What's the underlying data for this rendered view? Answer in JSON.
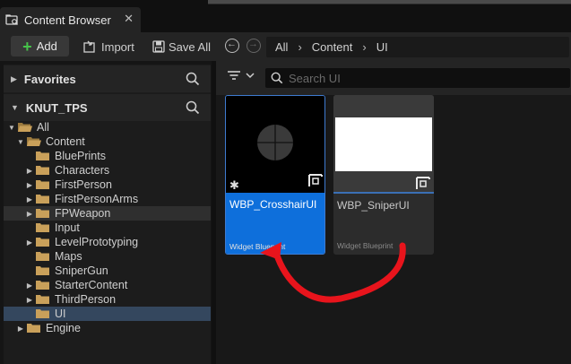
{
  "tab": {
    "title": "Content Browser",
    "icon": "content-browser-icon",
    "close_icon": "close-icon",
    "close_glyph": "✕"
  },
  "toolbar": {
    "add_label": "Add",
    "import_label": "Import",
    "save_all_label": "Save All",
    "back_icon": "arrow-left-circle-icon",
    "forward_icon": "arrow-right-circle-icon"
  },
  "breadcrumb": {
    "items": [
      "All",
      "Content",
      "UI"
    ],
    "separator": "›"
  },
  "left_panel": {
    "favorites_label": "Favorites",
    "project_label": "KNUT_TPS",
    "tree": [
      {
        "label": "All"
      },
      {
        "label": "Content"
      },
      {
        "label": "BluePrints"
      },
      {
        "label": "Characters"
      },
      {
        "label": "FirstPerson"
      },
      {
        "label": "FirstPersonArms"
      },
      {
        "label": "FPWeapon"
      },
      {
        "label": "Input"
      },
      {
        "label": "LevelPrototyping"
      },
      {
        "label": "Maps"
      },
      {
        "label": "SniperGun"
      },
      {
        "label": "StarterContent"
      },
      {
        "label": "ThirdPerson"
      },
      {
        "label": "UI"
      },
      {
        "label": "Engine"
      }
    ]
  },
  "filter_bar": {
    "search_placeholder": "Search UI",
    "filter_icon": "filter-icon"
  },
  "assets": [
    {
      "name": "WBP_CrosshairUI",
      "type": "Widget Blueprint",
      "selected": true,
      "unsaved_marker": "✱"
    },
    {
      "name": "WBP_SniperUI",
      "type": "Widget Blueprint",
      "selected": false
    }
  ],
  "colors": {
    "accent": "#0e6fdb",
    "add_plus": "#46c34a",
    "folder": "#c9a05a",
    "selection_row": "#34475e",
    "annotation_arrow": "#e8141c"
  }
}
